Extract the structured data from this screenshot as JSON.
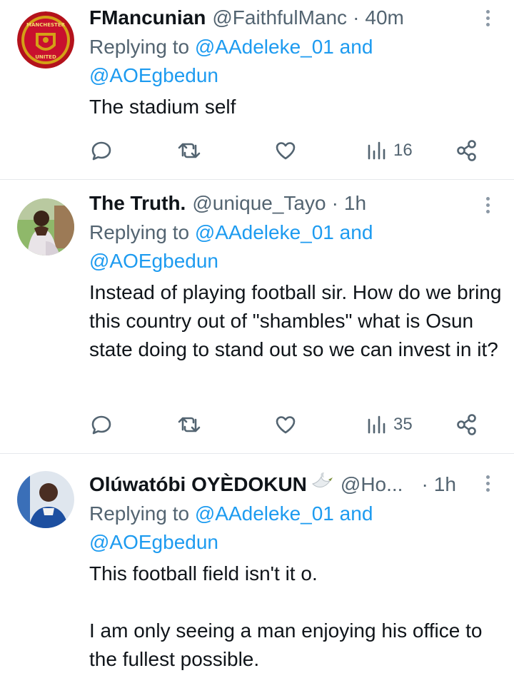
{
  "tweets": [
    {
      "name": "FMancunian",
      "handle": "@FaithfulManc",
      "dot": "·",
      "time": "40m",
      "replying_prefix": "Replying to",
      "replying_user1": "@AAdeleke_01",
      "replying_and": "and",
      "replying_user2": "@AOEgbedun",
      "text": "The stadium self",
      "views": "16",
      "avatar_icon": "manchester-united-crest",
      "avatar_text": "MANCHESTER UNITED",
      "avatar_color": "#c8102e"
    },
    {
      "name": "The Truth.",
      "handle": "@unique_Tayo",
      "dot": "·",
      "time": "1h",
      "replying_prefix": "Replying to",
      "replying_user1": "@AAdeleke_01",
      "replying_and": "and",
      "replying_user2": "@AOEgbedun",
      "text": "Instead of playing football sir. How do we bring this country out of \"shambles\" what is Osun state doing to stand out so we can invest in it?",
      "views": "35",
      "avatar_icon": "person-photo"
    },
    {
      "name": "Olúwatóbi OYÈDOKUN",
      "name_emoji": "dove-icon",
      "handle": "@Ho...",
      "dot": "·",
      "time": "1h",
      "replying_prefix": "Replying to",
      "replying_user1": "@AAdeleke_01",
      "replying_and": "and",
      "replying_user2": "@AOEgbedun",
      "text": "This football field isn't it o.\n\nI am only seeing a man enjoying his office to the fullest possible.",
      "avatar_icon": "person-photo"
    }
  ],
  "colors": {
    "link": "#1d9bf0",
    "secondary": "#536471",
    "text": "#0f1419",
    "divider": "#e6e9ec"
  }
}
